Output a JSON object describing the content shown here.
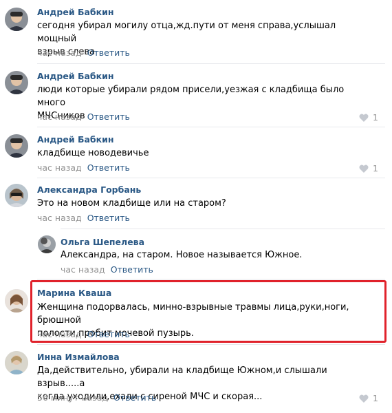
{
  "comments": [
    {
      "author": "Андрей Бабкин",
      "text_line1": "сегодня убирал могилу отца,жд.пути от меня справа,услышал мощный",
      "text_line2": "взрыв слева",
      "time": "час назад",
      "reply": "Ответить",
      "likes": ""
    },
    {
      "author": "Андрей Бабкин",
      "text_line1": "люди которые убирали рядом присели,уезжая с кладбища было много",
      "text_line2": "МЧСников",
      "time": "час назад",
      "reply": "Ответить",
      "likes": "1"
    },
    {
      "author": "Андрей Бабкин",
      "text_line1": "кладбище новодевичье",
      "text_line2": "",
      "time": "час назад",
      "reply": "Ответить",
      "likes": "1"
    },
    {
      "author": "Александра Горбань",
      "text_line1": "Это на новом кладбище или на старом?",
      "text_line2": "",
      "time": "час назад",
      "reply": "Ответить",
      "likes": ""
    },
    {
      "author": "Ольга Шепелева",
      "text_line1": "Александра, на старом. Новое называется Южное.",
      "text_line2": "",
      "time": "час назад",
      "reply": "Ответить",
      "likes": ""
    },
    {
      "author": "Марина Кваша",
      "text_line1": "Женщина подорвалась, минно-взрывные травмы лица,руки,ноги, брюшной",
      "text_line2": "полости,пробит мочевой пузырь.",
      "time": "час назад",
      "reply": "Ответить",
      "likes": ""
    },
    {
      "author": "Инна Измайлова",
      "text_line1": "Да,действительно, убирали на кладбище Южном,и слышали взрыв.....а",
      "text_line2": "когда уходили,ехали с сиреной МЧС и скорая...",
      "time": "56 минут назад",
      "reply": "Ответить",
      "likes": "1"
    }
  ],
  "colors": {
    "link": "#2a5885",
    "meta": "#939393",
    "highlight": "#e0222b"
  }
}
